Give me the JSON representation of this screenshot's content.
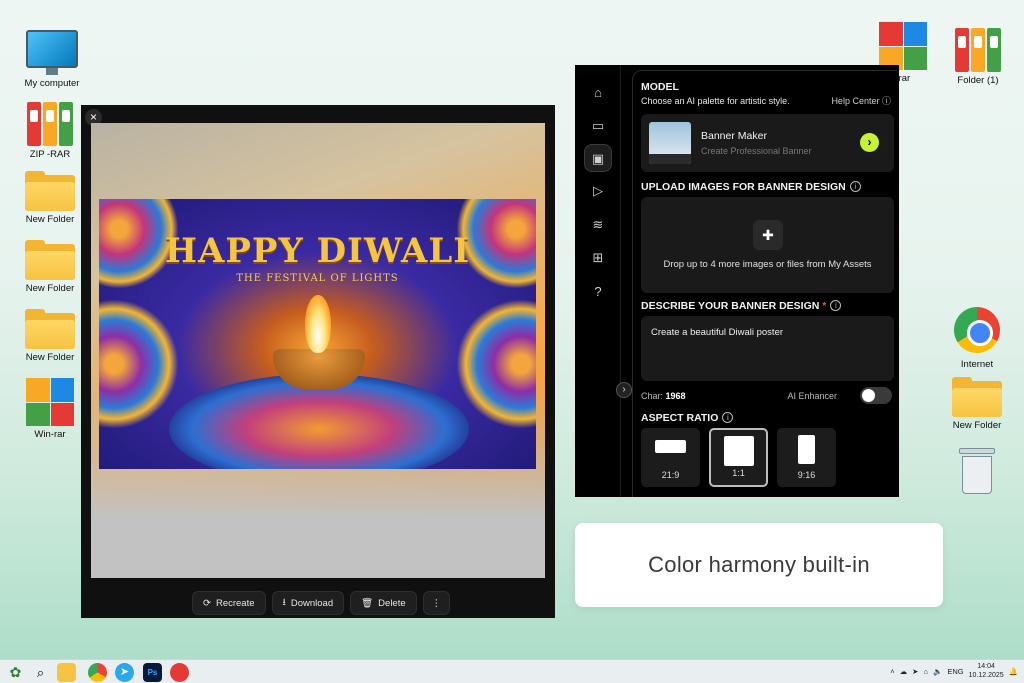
{
  "desktop": {
    "icons_left": [
      {
        "label": "My computer",
        "icon": "computer-icon"
      },
      {
        "label": "ZIP -RAR",
        "icon": "binders-icon"
      },
      {
        "label": "New Folder",
        "icon": "folder-icon"
      },
      {
        "label": "New Folder",
        "icon": "folder-icon"
      },
      {
        "label": "New Folder",
        "icon": "folder-icon"
      },
      {
        "label": "Win-rar",
        "icon": "winrar-icon"
      }
    ],
    "icons_right": [
      {
        "label": "Win-rar",
        "icon": "winrar-icon",
        "visible": "in-rar"
      },
      {
        "label": "Folder (1)",
        "icon": "binders-icon"
      },
      {
        "label": "Internet",
        "icon": "chrome-icon"
      },
      {
        "label": "New Folder",
        "icon": "folder-icon"
      },
      {
        "label": "",
        "icon": "recycle-bin-icon"
      }
    ]
  },
  "preview": {
    "close": "×",
    "poster": {
      "title": "HAPPY DIWALI",
      "subtitle": "THE FESTIVAL OF LIGHTS"
    },
    "actions": {
      "recreate": "Recreate",
      "download": "Download",
      "delete": "Delete",
      "more": "⋮"
    }
  },
  "panel": {
    "model": {
      "heading": "MODEL",
      "subtitle": "Choose an AI palette for artistic style.",
      "help": "Help Center",
      "card_name": "Banner Maker",
      "card_desc": "Create Professional Banner",
      "thumb_label": "BANNER MAKER"
    },
    "upload": {
      "heading": "UPLOAD IMAGES FOR BANNER DESIGN",
      "hint": "Drop up to 4 more images or files from My Assets"
    },
    "describe": {
      "heading": "DESCRIBE YOUR BANNER DESIGN",
      "required": "*",
      "value": "Create a beautiful Diwali poster"
    },
    "char_label": "Char:",
    "char_count": "1968",
    "enhancer_label": "AI Enhancer",
    "enhancer_on": false,
    "aspect": {
      "heading": "ASPECT RATIO",
      "options": [
        {
          "label": "21:9"
        },
        {
          "label": "1:1",
          "selected": true
        },
        {
          "label": "9:16"
        }
      ]
    }
  },
  "caption": "Color harmony built-in",
  "taskbar": {
    "lang": "ENG",
    "time": "14:04",
    "date": "10.12.2025"
  },
  "colors": {
    "accent": "#c6f432",
    "panel_bg": "#000000",
    "card_bg": "#1a1a1a"
  }
}
